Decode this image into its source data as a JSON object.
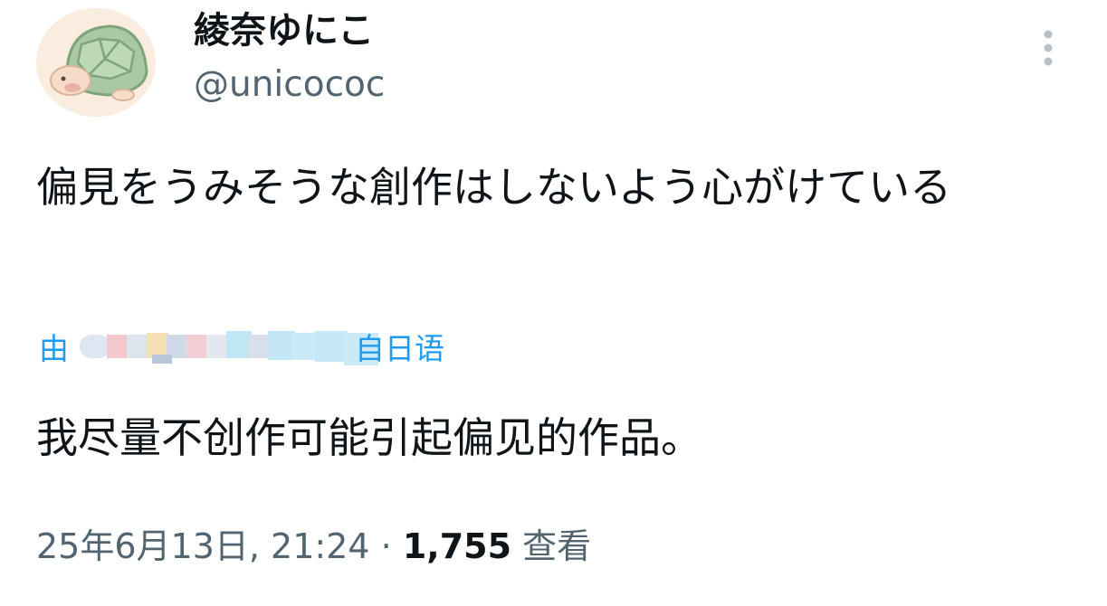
{
  "author": {
    "name": "綾奈ゆにこ",
    "handle": "@unicococ",
    "avatar_icon": "turtle-avatar"
  },
  "more_icon": "more-vertical-icon",
  "tweet": {
    "text": "偏見をうみそうな創作はしないよう心がけている"
  },
  "translation": {
    "prefix": "由",
    "suffix": "自日语",
    "text": "我尽量不创作可能引起偏见的作品。"
  },
  "meta": {
    "timestamp": "25年6月13日, 21:24",
    "separator": "·",
    "views_count": "1,755",
    "views_label": "查看"
  },
  "colors": {
    "link": "#1d9bf0",
    "secondary_text": "#536471",
    "primary_text": "#0f1419"
  }
}
